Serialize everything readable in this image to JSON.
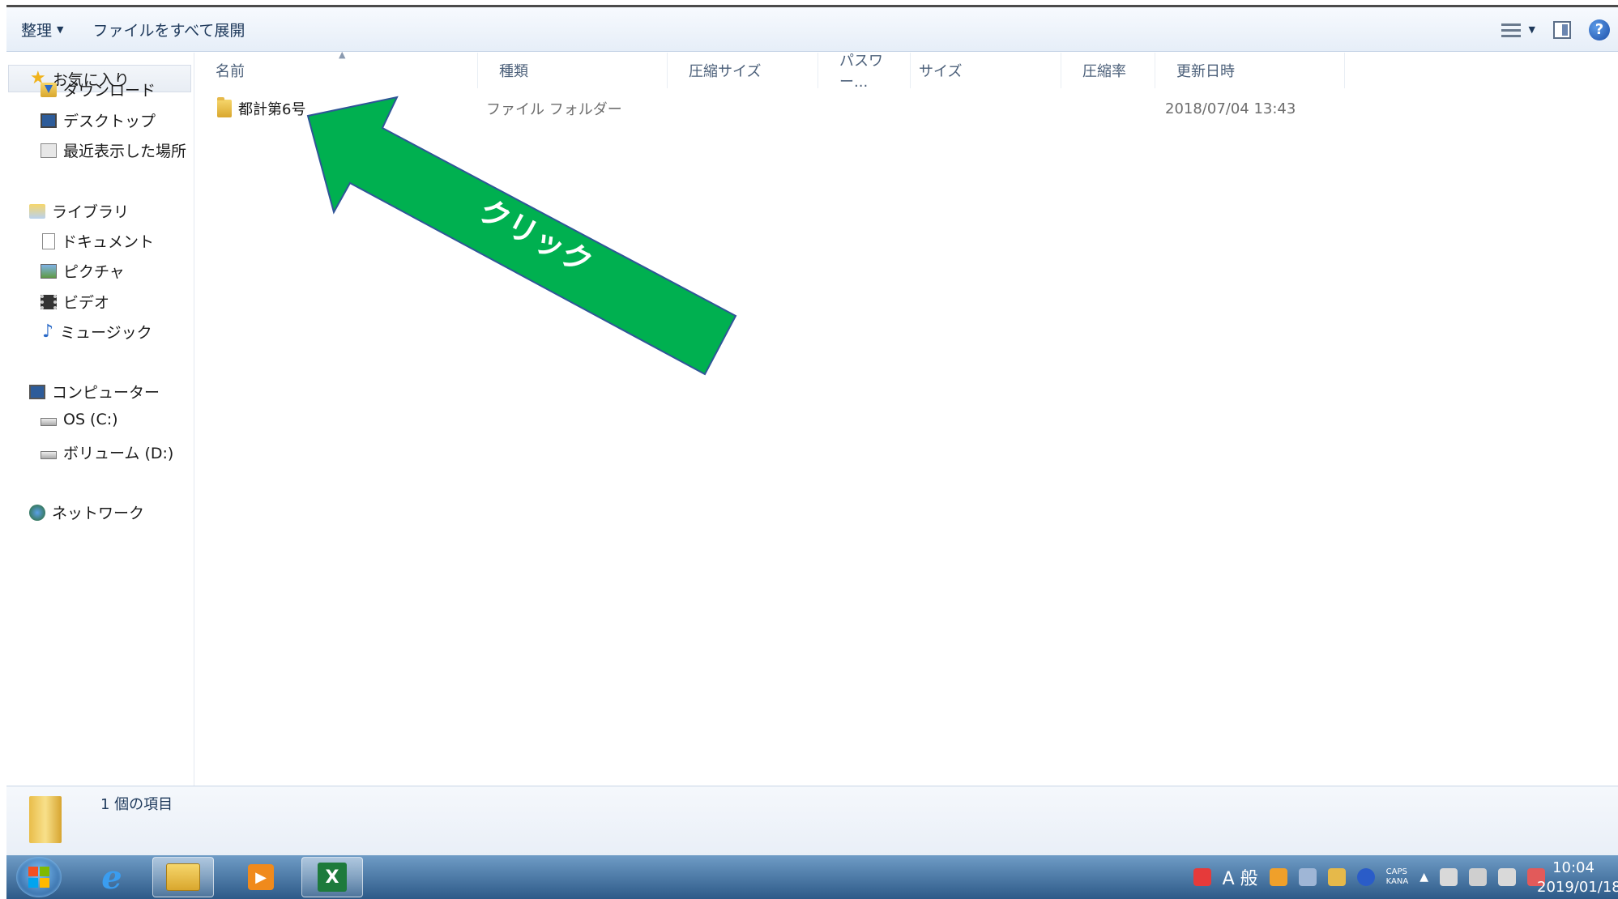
{
  "toolbar": {
    "organize_label": "整理",
    "expand_all_label": "ファイルをすべて展開"
  },
  "nav": {
    "favorites": "お気に入り",
    "downloads": "ダウンロード",
    "desktop": "デスクトップ",
    "recent": "最近表示した場所",
    "libraries": "ライブラリ",
    "documents": "ドキュメント",
    "pictures": "ピクチャ",
    "videos": "ビデオ",
    "music": "ミュージック",
    "computer": "コンピューター",
    "drive_c": "OS (C:)",
    "drive_d": "ボリューム (D:)",
    "network": "ネットワーク"
  },
  "columns": {
    "name": "名前",
    "type": "種類",
    "compressed_size": "圧縮サイズ",
    "password": "パスワー...",
    "size": "サイズ",
    "ratio": "圧縮率",
    "modified": "更新日時"
  },
  "files": [
    {
      "name": "都計第6号",
      "type": "ファイル フォルダー",
      "modified": "2018/07/04 13:43"
    }
  ],
  "annotation": {
    "text": "クリック",
    "color": "#00b050"
  },
  "status": {
    "item_count": "1 個の項目"
  },
  "taskbar": {
    "tray_caps": "CAPS",
    "tray_kana": "KANA",
    "ime_mode": "A 般",
    "time": "10:04",
    "date": "2019/01/18"
  },
  "icons": {
    "organize": "chevron-down-icon",
    "view": "view-list-icon",
    "preview_pane": "preview-pane-icon",
    "help": "help-icon"
  }
}
